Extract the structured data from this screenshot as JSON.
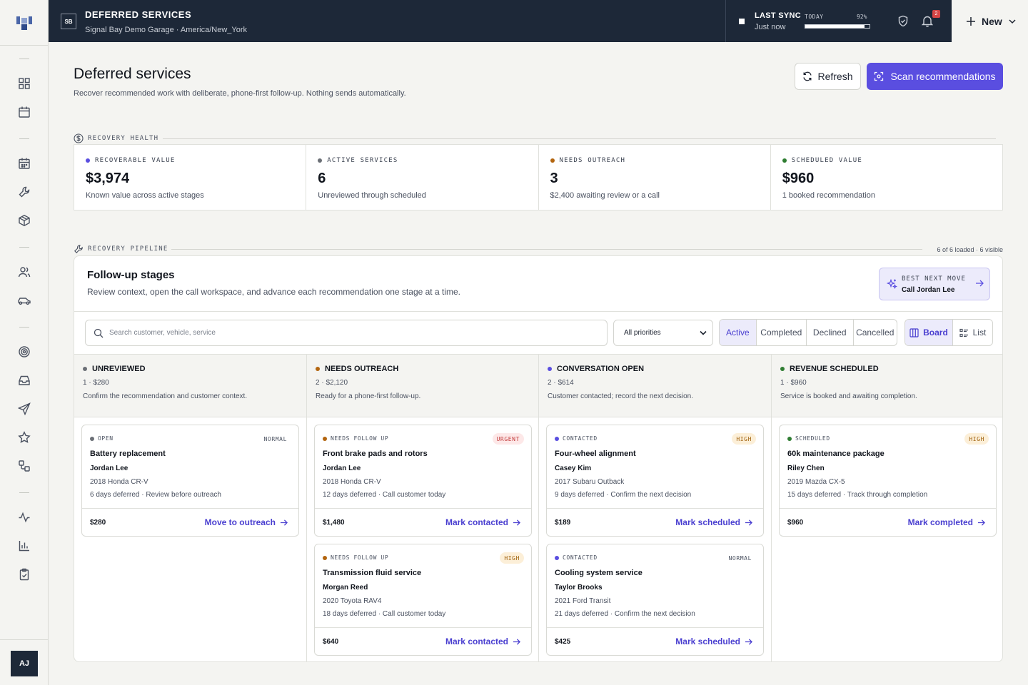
{
  "app": {
    "logo": "brand-mark",
    "badge": "SB",
    "title": "DEFERRED SERVICES",
    "subtitle": "Signal Bay Demo Garage · America/New_York"
  },
  "sync": {
    "title": "LAST SYNC",
    "subtitle": "Just now",
    "today_label": "TODAY",
    "percent_label": "92%",
    "percent": 92
  },
  "notifications": {
    "count": "2"
  },
  "new_button": {
    "label": "New"
  },
  "user": {
    "initials": "AJ"
  },
  "sidebar": {
    "icons": [
      "grid-icon",
      "calendar-icon",
      "calendar-grid-icon",
      "wrench-icon",
      "box-icon",
      "users-icon",
      "car-icon",
      "target-icon",
      "inbox-icon",
      "send-icon",
      "star-icon",
      "workflow-icon",
      "activity-icon",
      "bar-chart-icon",
      "clipboard-check-icon"
    ]
  },
  "page": {
    "title": "Deferred services",
    "subtitle": "Recover recommended work with deliberate, phone-first follow-up. Nothing sends automatically.",
    "refresh_label": "Refresh",
    "scan_label": "Scan recommendations"
  },
  "health": {
    "section_label": "RECOVERY HEALTH",
    "metrics": [
      {
        "label": "RECOVERABLE VALUE",
        "value": "$3,974",
        "note": "Known value across active stages",
        "color": "#5a4ee0"
      },
      {
        "label": "ACTIVE SERVICES",
        "value": "6",
        "note": "Unreviewed through scheduled",
        "color": "#6b6f76"
      },
      {
        "label": "NEEDS OUTREACH",
        "value": "3",
        "note": "$2,400 awaiting review or a call",
        "color": "#b3650f"
      },
      {
        "label": "SCHEDULED VALUE",
        "value": "$960",
        "note": "1 booked recommendation",
        "color": "#2f7d32"
      }
    ]
  },
  "pipeline": {
    "section_label": "RECOVERY PIPELINE",
    "count_label": "6 of 6 loaded · 6 visible",
    "title": "Follow-up stages",
    "subtitle": "Review context, open the call workspace, and advance each recommendation one stage at a time.",
    "best_move": {
      "label": "BEST NEXT MOVE",
      "value": "Call Jordan Lee"
    },
    "search_placeholder": "Search customer, vehicle, service",
    "priority_filter": "All priorities",
    "status_tabs": [
      "Active",
      "Completed",
      "Declined",
      "Cancelled"
    ],
    "active_tab": "Active",
    "view_tabs": [
      "Board",
      "List"
    ],
    "active_view": "Board",
    "columns": [
      {
        "name": "UNREVIEWED",
        "count": "1 · $280",
        "desc": "Confirm the recommendation and customer context.",
        "color": "#6b6f76",
        "cards": [
          {
            "status": "OPEN",
            "status_color": "#6b6f76",
            "priority": "NORMAL",
            "title": "Battery replacement",
            "customer": "Jordan Lee",
            "vehicle": "2018 Honda CR-V",
            "note": "6 days deferred · Review before outreach",
            "value": "$280",
            "action": "Move to outreach"
          }
        ]
      },
      {
        "name": "NEEDS OUTREACH",
        "count": "2 · $2,120",
        "desc": "Ready for a phone-first follow-up.",
        "color": "#b3650f",
        "cards": [
          {
            "status": "NEEDS FOLLOW UP",
            "status_color": "#b3650f",
            "priority": "URGENT",
            "title": "Front brake pads and rotors",
            "customer": "Jordan Lee",
            "vehicle": "2018 Honda CR-V",
            "note": "12 days deferred · Call customer today",
            "value": "$1,480",
            "action": "Mark contacted"
          },
          {
            "status": "NEEDS FOLLOW UP",
            "status_color": "#b3650f",
            "priority": "HIGH",
            "title": "Transmission fluid service",
            "customer": "Morgan Reed",
            "vehicle": "2020 Toyota RAV4",
            "note": "18 days deferred · Call customer today",
            "value": "$640",
            "action": "Mark contacted"
          }
        ]
      },
      {
        "name": "CONVERSATION OPEN",
        "count": "2 · $614",
        "desc": "Customer contacted; record the next decision.",
        "color": "#5a4ee0",
        "cards": [
          {
            "status": "CONTACTED",
            "status_color": "#5a4ee0",
            "priority": "HIGH",
            "title": "Four-wheel alignment",
            "customer": "Casey Kim",
            "vehicle": "2017 Subaru Outback",
            "note": "9 days deferred · Confirm the next decision",
            "value": "$189",
            "action": "Mark scheduled"
          },
          {
            "status": "CONTACTED",
            "status_color": "#5a4ee0",
            "priority": "NORMAL",
            "title": "Cooling system service",
            "customer": "Taylor Brooks",
            "vehicle": "2021 Ford Transit",
            "note": "21 days deferred · Confirm the next decision",
            "value": "$425",
            "action": "Mark scheduled"
          }
        ]
      },
      {
        "name": "REVENUE SCHEDULED",
        "count": "1 · $960",
        "desc": "Service is booked and awaiting completion.",
        "color": "#2f7d32",
        "cards": [
          {
            "status": "SCHEDULED",
            "status_color": "#2f7d32",
            "priority": "HIGH",
            "title": "60k maintenance package",
            "customer": "Riley Chen",
            "vehicle": "2019 Mazda CX-5",
            "note": "15 days deferred · Track through completion",
            "value": "$960",
            "action": "Mark completed"
          }
        ]
      }
    ]
  },
  "priority_styles": {
    "NORMAL": {
      "bg": "#ffffff",
      "fg": "#4a5160"
    },
    "URGENT": {
      "bg": "#fde8e8",
      "fg": "#c23b3b"
    },
    "HIGH": {
      "bg": "#fcefd8",
      "fg": "#a0620e"
    }
  }
}
